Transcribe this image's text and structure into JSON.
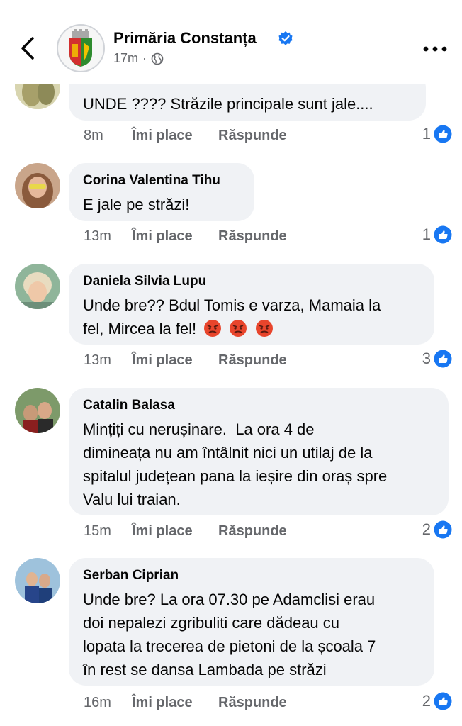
{
  "header": {
    "page_name": "Primăria Constanța",
    "time": "17m",
    "separator": "·"
  },
  "comments": [
    {
      "author": "",
      "text": "UNDE ???? Străzile principale sunt jale....",
      "time": "8m",
      "like_label": "Îmi place",
      "reply_label": "Răspunde",
      "likes": "1"
    },
    {
      "author": "Corina Valentina Tihu",
      "text": "E jale pe străzi!",
      "time": "13m",
      "like_label": "Îmi place",
      "reply_label": "Răspunde",
      "likes": "1"
    },
    {
      "author": "Daniela Silvia Lupu",
      "text_line1": "Unde bre?? Bdul Tomis e varza, Mamaia la",
      "text_line2": "fel, Mircea la fel!",
      "time": "13m",
      "like_label": "Îmi place",
      "reply_label": "Răspunde",
      "likes": "3"
    },
    {
      "author": "Catalin Balasa",
      "lines": [
        "Mințiți cu nerușinare.  La ora 4 de",
        "dimineața nu am întâlnit nici un utilaj de la",
        "spitalul județean pana la ieșire din oraș spre",
        "Valu lui traian."
      ],
      "time": "15m",
      "like_label": "Îmi place",
      "reply_label": "Răspunde",
      "likes": "2"
    },
    {
      "author": "Serban Ciprian",
      "lines": [
        "Unde bre? La ora 07.30 pe Adamclisi erau",
        "doi nepalezi zgribuliti care dădeau cu",
        "lopata la trecerea de pietoni de la școala 7",
        "în rest se dansa Lambada pe străzi"
      ],
      "time": "16m",
      "like_label": "Îmi place",
      "reply_label": "Răspunde",
      "likes": "2"
    }
  ],
  "colors": {
    "accent": "#1877f2",
    "bubble": "#f0f2f5",
    "muted": "#65676b"
  }
}
